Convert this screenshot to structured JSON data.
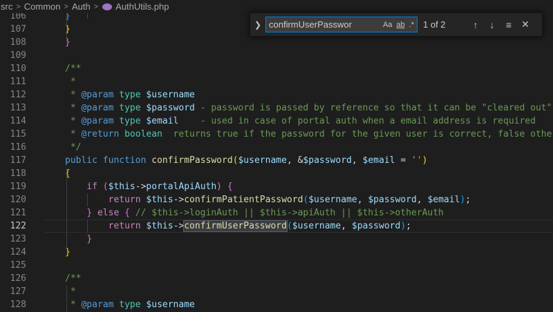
{
  "breadcrumb": {
    "items": [
      "src",
      "Common",
      "Auth"
    ],
    "file": "AuthUtils.php"
  },
  "find": {
    "toggle_icon": "chevron-right-icon",
    "query": "confirmUserPassword",
    "match_case": "Aa",
    "whole_word": "ab",
    "regex": ".*",
    "count": "1 of 2",
    "prev_icon": "↑",
    "next_icon": "↓",
    "selection_icon": "≡",
    "close_icon": "✕"
  },
  "editor": {
    "current_line": 122,
    "lines": [
      {
        "n": "106",
        "tokens": [
          {
            "t": "}",
            "c": "t-b3"
          }
        ]
      },
      {
        "n": "107",
        "tokens": [
          {
            "t": "}",
            "c": "t-b1"
          }
        ]
      },
      {
        "n": "108",
        "tokens": [
          {
            "t": "}",
            "c": "t-b2"
          }
        ]
      },
      {
        "n": "109",
        "tokens": []
      },
      {
        "n": "110",
        "tokens": [
          {
            "t": "/**",
            "c": "t-comment"
          }
        ]
      },
      {
        "n": "111",
        "tokens": [
          {
            "t": " *",
            "c": "t-comment"
          }
        ]
      },
      {
        "n": "112",
        "tokens": [
          {
            "t": " * ",
            "c": "t-comment"
          },
          {
            "t": "@param",
            "c": "t-doctag"
          },
          {
            "t": " type",
            "c": "t-doctype"
          },
          {
            "t": " $username",
            "c": "t-var"
          }
        ]
      },
      {
        "n": "113",
        "tokens": [
          {
            "t": " * ",
            "c": "t-comment"
          },
          {
            "t": "@param",
            "c": "t-doctag"
          },
          {
            "t": " type",
            "c": "t-doctype"
          },
          {
            "t": " $password",
            "c": "t-var"
          },
          {
            "t": " - password is passed by reference so that it can be \"cleared out\"",
            "c": "t-comment"
          }
        ]
      },
      {
        "n": "114",
        "tokens": [
          {
            "t": " * ",
            "c": "t-comment"
          },
          {
            "t": "@param",
            "c": "t-doctag"
          },
          {
            "t": " type",
            "c": "t-doctype"
          },
          {
            "t": " $email",
            "c": "t-var"
          },
          {
            "t": "    - used in case of portal auth when a email address is required",
            "c": "t-comment"
          }
        ]
      },
      {
        "n": "115",
        "tokens": [
          {
            "t": " * ",
            "c": "t-comment"
          },
          {
            "t": "@return",
            "c": "t-doctag"
          },
          {
            "t": " boolean",
            "c": "t-doctype"
          },
          {
            "t": "  returns true if the password for the given user is correct, false other",
            "c": "t-comment"
          }
        ]
      },
      {
        "n": "116",
        "tokens": [
          {
            "t": " */",
            "c": "t-comment"
          }
        ]
      },
      {
        "n": "117",
        "tokens": [
          {
            "t": "public",
            "c": "t-kw"
          },
          {
            "t": " ",
            "c": "t-op"
          },
          {
            "t": "function",
            "c": "t-kw"
          },
          {
            "t": " ",
            "c": "t-op"
          },
          {
            "t": "confirmPassword",
            "c": "t-fn"
          },
          {
            "t": "(",
            "c": "t-b1"
          },
          {
            "t": "$username",
            "c": "t-var"
          },
          {
            "t": ", &",
            "c": "t-op"
          },
          {
            "t": "$password",
            "c": "t-var"
          },
          {
            "t": ", ",
            "c": "t-op"
          },
          {
            "t": "$email",
            "c": "t-var"
          },
          {
            "t": " = ",
            "c": "t-op"
          },
          {
            "t": "''",
            "c": "t-str"
          },
          {
            "t": ")",
            "c": "t-b1"
          }
        ]
      },
      {
        "n": "118",
        "tokens": [
          {
            "t": "{",
            "c": "t-b1"
          }
        ]
      },
      {
        "n": "119",
        "tokens": [
          {
            "t": "    ",
            "c": "t-op"
          },
          {
            "t": "if",
            "c": "t-ctrl"
          },
          {
            "t": " ",
            "c": "t-op"
          },
          {
            "t": "(",
            "c": "t-b2"
          },
          {
            "t": "$this",
            "c": "t-var"
          },
          {
            "t": "->",
            "c": "t-op"
          },
          {
            "t": "portalApiAuth",
            "c": "t-var"
          },
          {
            "t": ")",
            "c": "t-b2"
          },
          {
            "t": " ",
            "c": "t-op"
          },
          {
            "t": "{",
            "c": "t-b2"
          }
        ]
      },
      {
        "n": "120",
        "tokens": [
          {
            "t": "        ",
            "c": "t-op"
          },
          {
            "t": "return",
            "c": "t-ctrl"
          },
          {
            "t": " ",
            "c": "t-op"
          },
          {
            "t": "$this",
            "c": "t-var"
          },
          {
            "t": "->",
            "c": "t-op"
          },
          {
            "t": "confirmPatientPassword",
            "c": "t-fn"
          },
          {
            "t": "(",
            "c": "t-b3"
          },
          {
            "t": "$username",
            "c": "t-var"
          },
          {
            "t": ", ",
            "c": "t-op"
          },
          {
            "t": "$password",
            "c": "t-var"
          },
          {
            "t": ", ",
            "c": "t-op"
          },
          {
            "t": "$email",
            "c": "t-var"
          },
          {
            "t": ")",
            "c": "t-b3"
          },
          {
            "t": ";",
            "c": "t-op"
          }
        ]
      },
      {
        "n": "121",
        "tokens": [
          {
            "t": "    ",
            "c": "t-op"
          },
          {
            "t": "}",
            "c": "t-b2"
          },
          {
            "t": " ",
            "c": "t-op"
          },
          {
            "t": "else",
            "c": "t-ctrl"
          },
          {
            "t": " ",
            "c": "t-op"
          },
          {
            "t": "{",
            "c": "t-b2"
          },
          {
            "t": " // $this->loginAuth || $this->apiAuth || $this->otherAuth",
            "c": "t-comment"
          }
        ]
      },
      {
        "n": "122",
        "tokens": [
          {
            "t": "        ",
            "c": "t-op"
          },
          {
            "t": "return",
            "c": "t-ctrl"
          },
          {
            "t": " ",
            "c": "t-op"
          },
          {
            "t": "$this",
            "c": "t-var"
          },
          {
            "t": "->",
            "c": "t-op"
          },
          {
            "t": "confirmUserPassword",
            "c": "t-fn hl"
          },
          {
            "t": "(",
            "c": "t-b3"
          },
          {
            "t": "$username",
            "c": "t-var"
          },
          {
            "t": ", ",
            "c": "t-op"
          },
          {
            "t": "$password",
            "c": "t-var"
          },
          {
            "t": ")",
            "c": "t-b3"
          },
          {
            "t": ";",
            "c": "t-op"
          }
        ]
      },
      {
        "n": "123",
        "tokens": [
          {
            "t": "    ",
            "c": "t-op"
          },
          {
            "t": "}",
            "c": "t-b2"
          }
        ]
      },
      {
        "n": "124",
        "tokens": [
          {
            "t": "}",
            "c": "t-b1"
          }
        ]
      },
      {
        "n": "125",
        "tokens": []
      },
      {
        "n": "126",
        "tokens": [
          {
            "t": "/**",
            "c": "t-comment"
          }
        ]
      },
      {
        "n": "127",
        "tokens": [
          {
            "t": " *",
            "c": "t-comment"
          }
        ]
      },
      {
        "n": "128",
        "tokens": [
          {
            "t": " * ",
            "c": "t-comment"
          },
          {
            "t": "@param",
            "c": "t-doctag"
          },
          {
            "t": " type",
            "c": "t-doctype"
          },
          {
            "t": " $username",
            "c": "t-var"
          }
        ]
      }
    ]
  }
}
